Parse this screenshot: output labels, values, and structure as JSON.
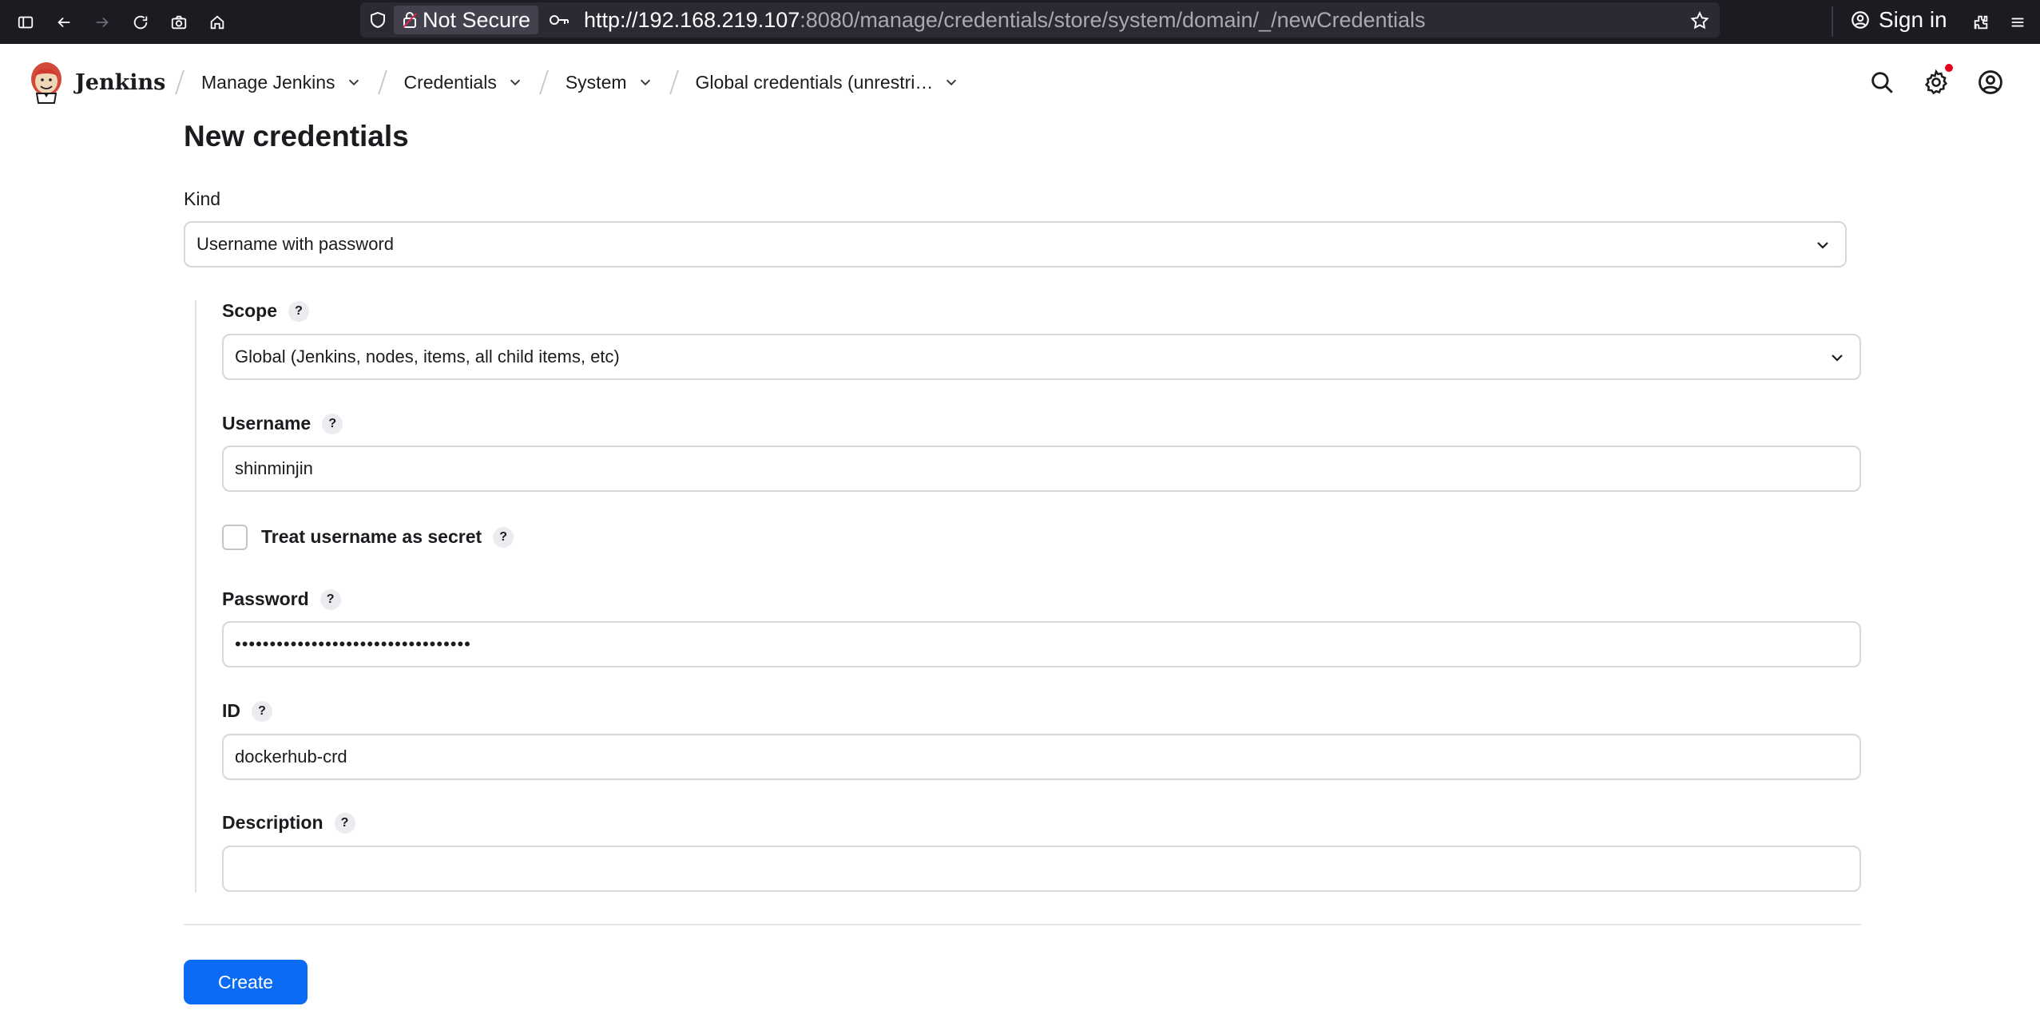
{
  "browser": {
    "not_secure_label": "Not Secure",
    "url_host": "http://192.168.219.107",
    "url_rest": ":8080/manage/credentials/store/system/domain/_/newCredentials",
    "sign_in_label": "Sign in"
  },
  "header": {
    "brand": "Jenkins",
    "breadcrumbs": [
      {
        "label": "Manage Jenkins"
      },
      {
        "label": "Credentials"
      },
      {
        "label": "System"
      },
      {
        "label": "Global credentials (unrestri…"
      }
    ]
  },
  "form": {
    "title": "New credentials",
    "kind": {
      "label": "Kind",
      "value": "Username with password"
    },
    "scope": {
      "label": "Scope",
      "help": "?",
      "value": "Global (Jenkins, nodes, items, all child items, etc)"
    },
    "username": {
      "label": "Username",
      "help": "?",
      "value": "shinminjin"
    },
    "treat_secret": {
      "label": "Treat username as secret",
      "help": "?",
      "checked": false
    },
    "password": {
      "label": "Password",
      "help": "?",
      "value": "••••••••••••••••••••••••••••••••••"
    },
    "id": {
      "label": "ID",
      "help": "?",
      "value": "dockerhub-crd"
    },
    "description": {
      "label": "Description",
      "help": "?",
      "value": ""
    },
    "create_label": "Create"
  },
  "colors": {
    "accent": "#0b6bf2",
    "browser_bg": "#1c1b22",
    "notification": "#e6001f"
  }
}
